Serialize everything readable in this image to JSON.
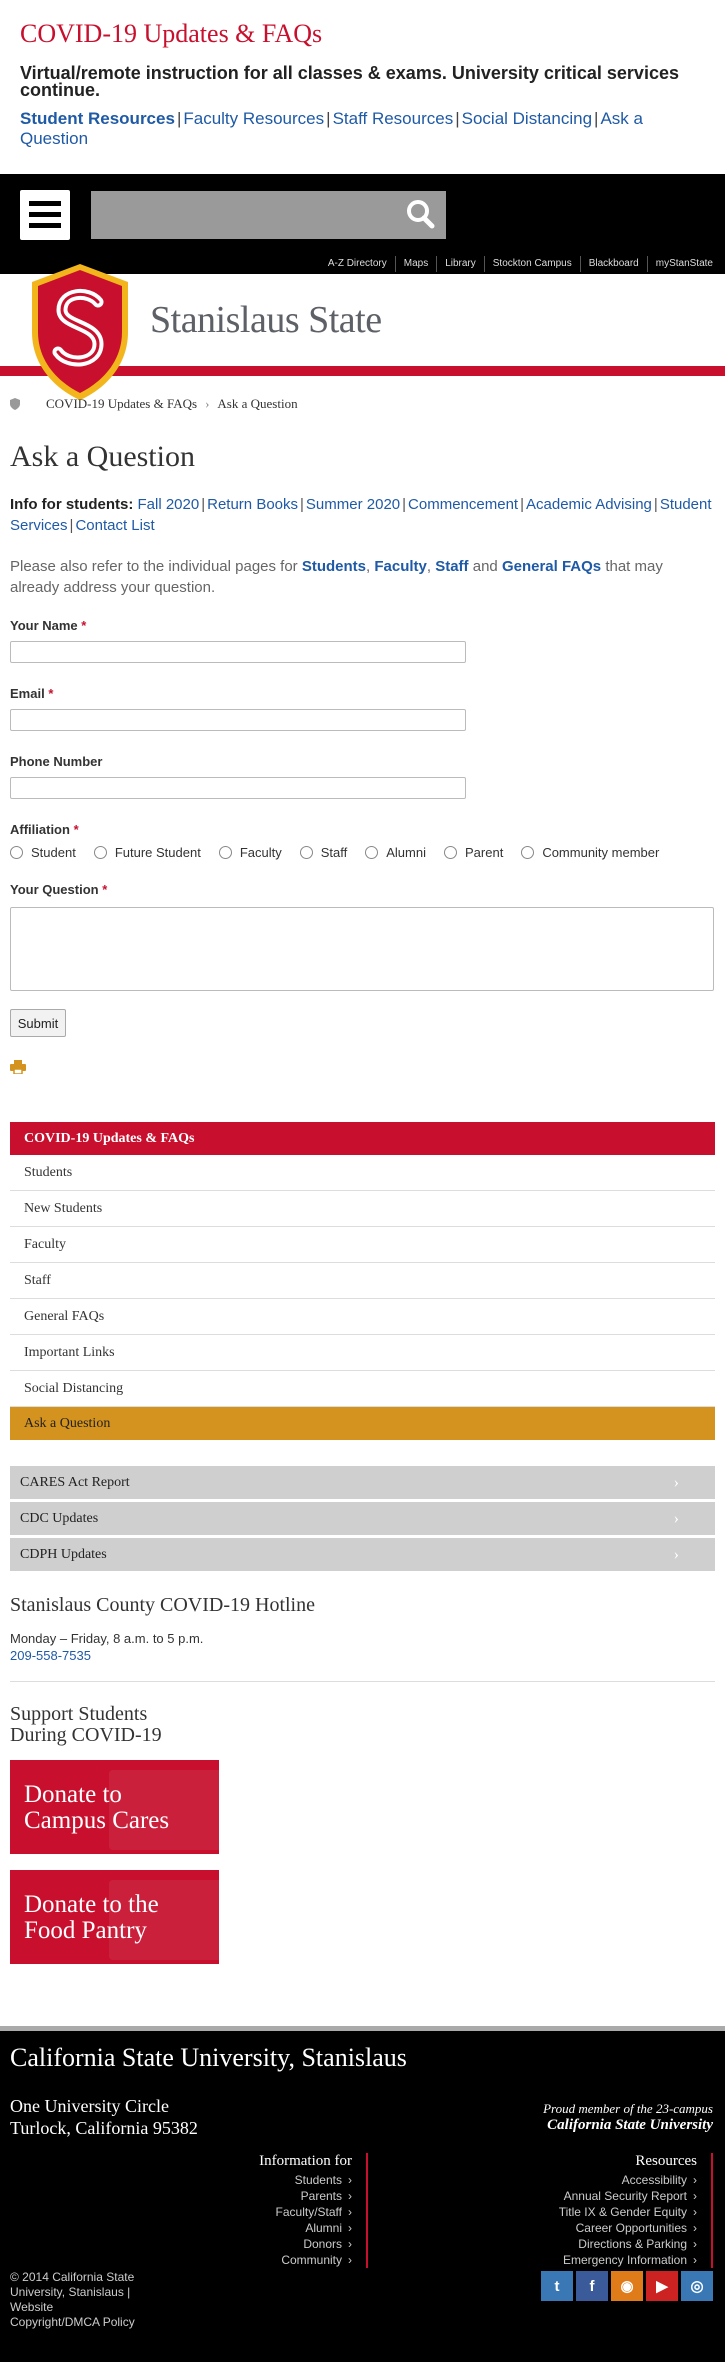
{
  "alert": {
    "title": "COVID-19 Updates & FAQs",
    "message": "Virtual/remote instruction for all classes & exams. University critical services continue.",
    "links": [
      "Student Resources",
      "Faculty Resources",
      "Staff Resources",
      "Social Distancing",
      "Ask a Question"
    ]
  },
  "header": {
    "utility_links": [
      "A-Z Directory",
      "Maps",
      "Library",
      "Stockton Campus",
      "Blackboard",
      "myStanState"
    ],
    "wordmark": "Stanislaus State"
  },
  "breadcrumb": {
    "items": [
      "COVID-19 Updates & FAQs",
      "Ask a Question"
    ]
  },
  "page": {
    "title": "Ask a Question",
    "info_label": "Info for students:",
    "info_links": [
      "Fall 2020",
      "Return Books",
      "Summer 2020",
      "Commencement",
      "Academic Advising",
      "Student Services",
      "Contact List"
    ],
    "note_pre": "Please also refer to the individual pages for ",
    "note_links": [
      "Students",
      "Faculty",
      "Staff",
      "General FAQs"
    ],
    "note_and": " and ",
    "note_post": " that may already address your question."
  },
  "form": {
    "name_label": "Your Name",
    "email_label": "Email",
    "phone_label": "Phone Number",
    "affiliation_label": "Affiliation",
    "affiliations": [
      "Student",
      "Future Student",
      "Faculty",
      "Staff",
      "Alumni",
      "Parent",
      "Community member"
    ],
    "question_label": "Your Question",
    "required_mark": "*",
    "submit": "Submit"
  },
  "section_nav": {
    "heading": "COVID-19 Updates & FAQs",
    "items": [
      "Students",
      "New Students",
      "Faculty",
      "Staff",
      "General FAQs",
      "Important Links",
      "Social Distancing"
    ],
    "active": "Ask a Question"
  },
  "external_links": [
    "CARES Act Report",
    "CDC Updates",
    "CDPH Updates"
  ],
  "hotline": {
    "title": "Stanislaus County COVID-19 Hotline",
    "hours": "Monday – Friday, 8 a.m. to 5 p.m.",
    "phone": "209-558-7535"
  },
  "support": {
    "title_line1": "Support Students",
    "title_line2": "During COVID-19",
    "donate1_line1": "Donate to",
    "donate1_line2": "Campus Cares",
    "donate2_line1": "Donate to the",
    "donate2_line2": "Food Pantry"
  },
  "footer": {
    "university": "California State University, Stanislaus",
    "address_line1": "One University Circle",
    "address_line2": "Turlock, California 95382",
    "csu_line1": "Proud member of the 23-campus",
    "csu_line2": "California State University",
    "info_heading": "Information for",
    "info_links": [
      "Students",
      "Parents",
      "Faculty/Staff",
      "Alumni",
      "Donors",
      "Community"
    ],
    "resources_heading": "Resources",
    "resources_links": [
      "Accessibility",
      "Annual Security Report",
      "Title IX & Gender Equity",
      "Career Opportunities",
      "Directions & Parking",
      "Emergency Information"
    ],
    "copyright": "© 2014 California State University, Stanislaus |",
    "website": "Website",
    "dmca": "Copyright/DMCA Policy",
    "social": [
      {
        "icon": "twitter-icon",
        "color": "#3a78b5",
        "glyph": "t"
      },
      {
        "icon": "facebook-icon",
        "color": "#3b5a9a",
        "glyph": "f"
      },
      {
        "icon": "rss-icon",
        "color": "#e07b1a",
        "glyph": "◉"
      },
      {
        "icon": "youtube-icon",
        "color": "#cc2222",
        "glyph": "▶"
      },
      {
        "icon": "instagram-icon",
        "color": "#3a78b5",
        "glyph": "◎"
      }
    ]
  },
  "colors": {
    "brand_red": "#c8102e",
    "link_blue": "#1f5aa6",
    "active_gold": "#d4921e"
  }
}
